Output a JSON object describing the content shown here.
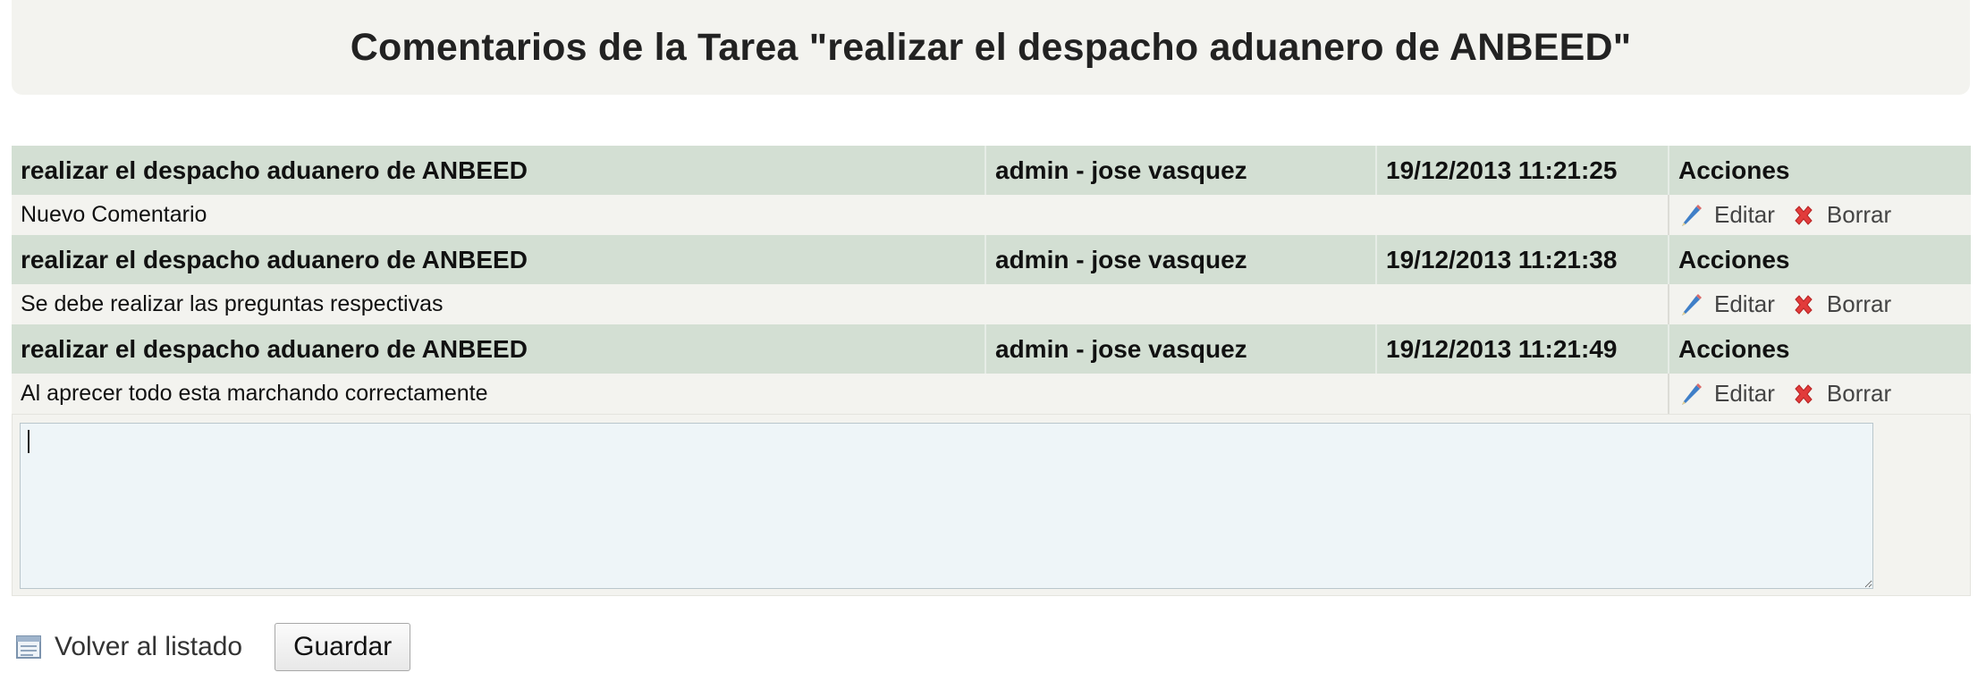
{
  "page": {
    "title": "Comentarios de la Tarea \"realizar el despacho aduanero de ANBEED\""
  },
  "comments": [
    {
      "task": "realizar el despacho aduanero de ANBEED",
      "user": "admin - jose vasquez",
      "datetime": "19/12/2013 11:21:25",
      "actions_label": "Acciones",
      "text": "Nuevo Comentario",
      "edit_label": "Editar",
      "delete_label": "Borrar"
    },
    {
      "task": "realizar el despacho aduanero de ANBEED",
      "user": "admin - jose vasquez",
      "datetime": "19/12/2013 11:21:38",
      "actions_label": "Acciones",
      "text": "Se debe realizar las preguntas respectivas",
      "edit_label": "Editar",
      "delete_label": "Borrar"
    },
    {
      "task": "realizar el despacho aduanero de ANBEED",
      "user": "admin - jose vasquez",
      "datetime": "19/12/2013 11:21:49",
      "actions_label": "Acciones",
      "text": "Al aprecer todo esta marchando correctamente",
      "edit_label": "Editar",
      "delete_label": "Borrar"
    }
  ],
  "editor": {
    "value": ""
  },
  "footer": {
    "back_label": "Volver al listado",
    "save_label": "Guardar"
  },
  "icons": {
    "edit": "pencil-icon",
    "delete": "red-x-icon",
    "back": "list-icon"
  },
  "colors": {
    "header_row_bg": "#d3dfd3",
    "body_row_bg": "#f3f3ef",
    "textarea_bg": "#eef5f8",
    "delete_icon": "#e23b3b",
    "edit_icon": "#3f7fc8"
  }
}
